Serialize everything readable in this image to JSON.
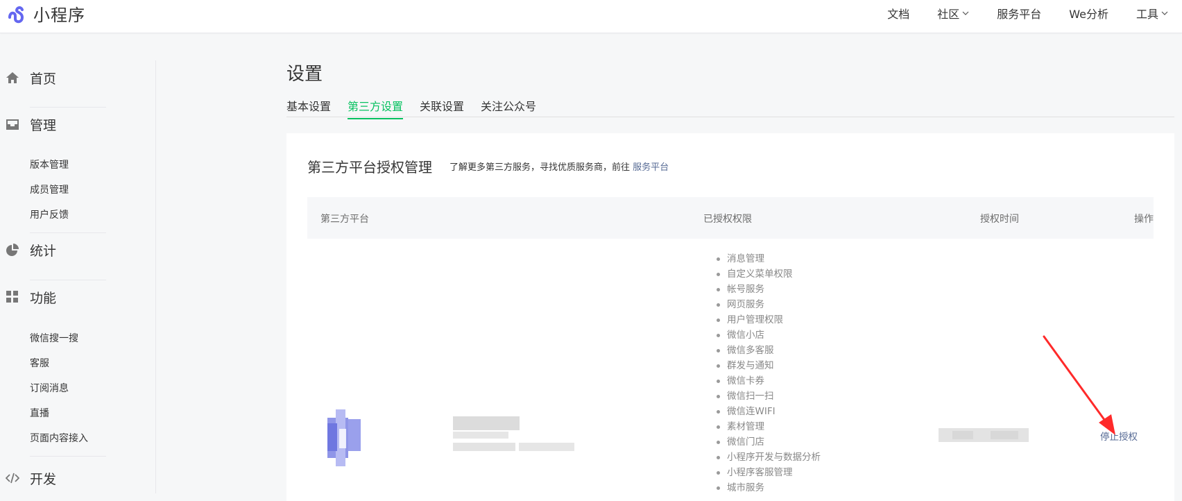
{
  "header": {
    "logo_text": "小程序",
    "nav": [
      {
        "label": "文档",
        "has_dropdown": false
      },
      {
        "label": "社区",
        "has_dropdown": true
      },
      {
        "label": "服务平台",
        "has_dropdown": false
      },
      {
        "label": "We分析",
        "has_dropdown": false
      },
      {
        "label": "工具",
        "has_dropdown": true
      }
    ]
  },
  "sidebar": {
    "sections": [
      {
        "label": "首页",
        "icon": "home-icon",
        "items": []
      },
      {
        "label": "管理",
        "icon": "inbox-icon",
        "items": [
          "版本管理",
          "成员管理",
          "用户反馈"
        ]
      },
      {
        "label": "统计",
        "icon": "pie-chart-icon",
        "items": []
      },
      {
        "label": "功能",
        "icon": "grid-icon",
        "items": [
          "微信搜一搜",
          "客服",
          "订阅消息",
          "直播",
          "页面内容接入"
        ]
      },
      {
        "label": "开发",
        "icon": "code-icon",
        "items": []
      }
    ]
  },
  "main": {
    "title": "设置",
    "tabs": [
      {
        "label": "基本设置",
        "active": false
      },
      {
        "label": "第三方设置",
        "active": true
      },
      {
        "label": "关联设置",
        "active": false
      },
      {
        "label": "关注公众号",
        "active": false
      }
    ],
    "card": {
      "title": "第三方平台授权管理",
      "desc_prefix": "了解更多第三方服务，寻找优质服务商，前往",
      "desc_link": "服务平台",
      "table": {
        "headers": {
          "platform": "第三方平台",
          "permissions": "已授权权限",
          "time": "授权时间",
          "action": "操作"
        },
        "row": {
          "permissions": [
            "消息管理",
            "自定义菜单权限",
            "帐号服务",
            "网页服务",
            "用户管理权限",
            "微信小店",
            "微信多客服",
            "群发与通知",
            "微信卡券",
            "微信扫一扫",
            "微信连WIFI",
            "素材管理",
            "微信门店",
            "小程序开发与数据分析",
            "小程序客服管理",
            "城市服务"
          ],
          "action": "停止授权"
        }
      }
    }
  },
  "colors": {
    "accent_green": "#07c160",
    "link_blue": "#576b95",
    "annotation_red": "#ff2a2a"
  }
}
